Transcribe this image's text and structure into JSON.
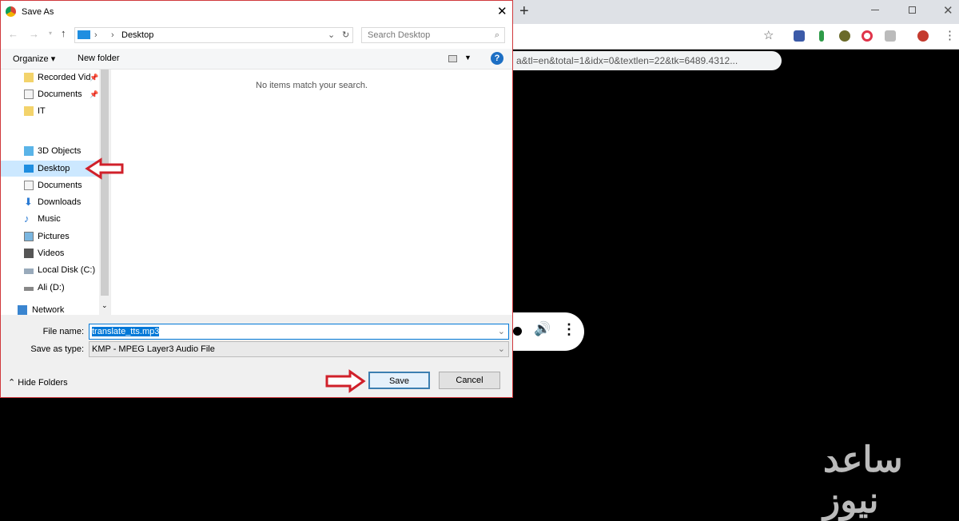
{
  "browser": {
    "new_tab": "+",
    "url": "a&tl=en&total=1&idx=0&textlen=22&tk=6489.4312...",
    "window_controls": [
      "minimize",
      "restore",
      "close"
    ]
  },
  "dialog": {
    "title": "Save As",
    "address": {
      "path": [
        "Desktop"
      ]
    },
    "search_placeholder": "Search Desktop",
    "organize": "Organize ▾",
    "new_folder": "New folder",
    "sidebar": [
      {
        "label": "Recorded Vid",
        "icon": "folder-icon",
        "pinned": true
      },
      {
        "label": "Documents",
        "icon": "documents-icon",
        "pinned": true
      },
      {
        "label": "IT",
        "icon": "folder-icon"
      },
      {
        "label": "3D Objects",
        "icon": "cube-icon"
      },
      {
        "label": "Desktop",
        "icon": "desktop-icon",
        "selected": true
      },
      {
        "label": "Documents",
        "icon": "documents-icon"
      },
      {
        "label": "Downloads",
        "icon": "download-icon"
      },
      {
        "label": "Music",
        "icon": "music-icon"
      },
      {
        "label": "Pictures",
        "icon": "pictures-icon"
      },
      {
        "label": "Videos",
        "icon": "videos-icon"
      },
      {
        "label": "Local Disk (C:)",
        "icon": "drive-icon"
      },
      {
        "label": "Ali (D:)",
        "icon": "drive-icon"
      },
      {
        "label": "Network",
        "icon": "network-icon"
      }
    ],
    "empty_message": "No items match your search.",
    "file_name_label": "File name:",
    "file_name": "translate_tts.mp3",
    "save_type_label": "Save as type:",
    "save_type": "KMP - MPEG Layer3 Audio File",
    "hide_folders": "Hide Folders",
    "save": "Save",
    "cancel": "Cancel"
  },
  "colors": {
    "annotation_arrow": "#d0202a",
    "selection": "#cce8ff",
    "accent": "#0078d7"
  },
  "watermark": "ساعد نیوز"
}
